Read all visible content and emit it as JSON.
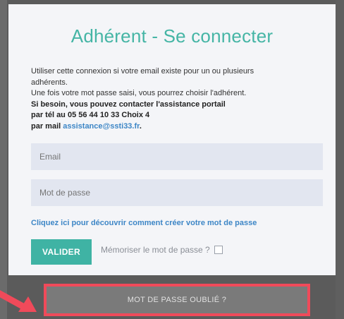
{
  "title": "Adhérent - Se connecter",
  "info": {
    "line1": "Utiliser cette connexion si votre email existe pour un ou plusieurs",
    "line2": "adhérents.",
    "line3": "Une fois votre mot passe saisi, vous pourrez choisir l'adhérent.",
    "line4": "Si besoin, vous pouvez contacter l'assistance portail",
    "line5": "par tél au 05 56 44 10 33 Choix 4",
    "mail_prefix": "par mail",
    "mail_address": "assistance@ssti33.fr",
    "mail_suffix": "."
  },
  "form": {
    "email_placeholder": "Email",
    "password_placeholder": "Mot de passe",
    "help_link": "Cliquez ici pour découvrir comment créer votre mot de passe",
    "submit_label": "VALIDER",
    "remember_label": "Mémoriser le mot de passe ?",
    "remember_checked": false
  },
  "forgot": {
    "label": "MOT DE PASSE OUBLIÉ ?"
  },
  "colors": {
    "accent": "#3fb3a4",
    "link": "#3d86c6",
    "highlight": "#f04a5a"
  }
}
